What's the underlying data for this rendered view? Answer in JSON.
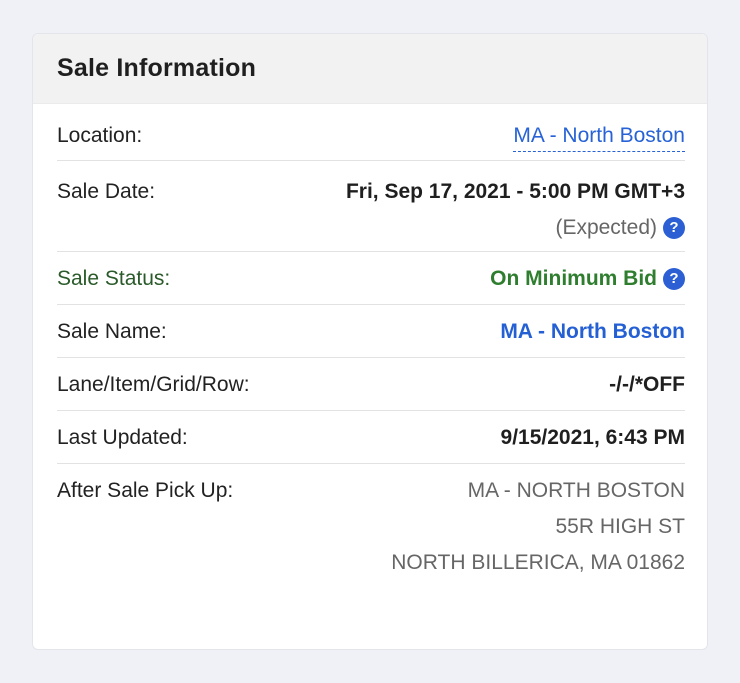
{
  "card": {
    "title": "Sale Information",
    "rows": {
      "location": {
        "label": "Location:",
        "value": "MA - North Boston"
      },
      "sale_date": {
        "label": "Sale Date:",
        "value": "Fri, Sep 17, 2021 - 5:00 PM GMT+3",
        "note": "(Expected)"
      },
      "sale_status": {
        "label": "Sale Status:",
        "value": "On Minimum Bid"
      },
      "sale_name": {
        "label": "Sale Name:",
        "value": "MA - North Boston"
      },
      "lane": {
        "label": "Lane/Item/Grid/Row:",
        "value": "-/-/*OFF"
      },
      "last_updated": {
        "label": "Last Updated:",
        "value": "9/15/2021, 6:43 PM"
      },
      "pickup": {
        "label": "After Sale Pick Up:",
        "lines": [
          "MA - NORTH BOSTON",
          "55R HIGH ST",
          "NORTH BILLERICA, MA 01862"
        ]
      }
    },
    "help_icon_glyph": "?"
  },
  "colors": {
    "link": "#2763d6",
    "status_highlight": "#a8ee9f",
    "status_text": "#2f7d2f",
    "help_icon": "#2c5fd3"
  },
  "icons": [
    "help-icon"
  ]
}
